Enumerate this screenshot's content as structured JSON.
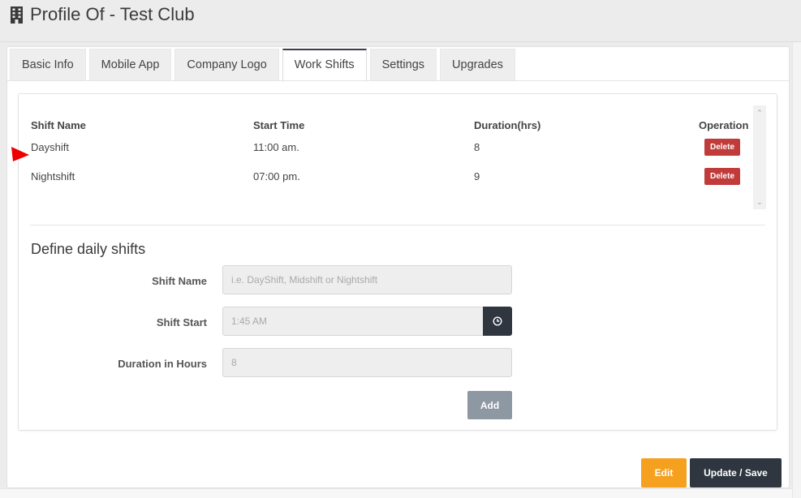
{
  "page": {
    "title": "Profile Of - Test Club",
    "title_icon": "building-icon"
  },
  "tabs": [
    {
      "label": "Basic Info",
      "active": false
    },
    {
      "label": "Mobile App",
      "active": false
    },
    {
      "label": "Company Logo",
      "active": false
    },
    {
      "label": "Work Shifts",
      "active": true
    },
    {
      "label": "Settings",
      "active": false
    },
    {
      "label": "Upgrades",
      "active": false
    }
  ],
  "shifts_table": {
    "columns": [
      "Shift Name",
      "Start Time",
      "Duration(hrs)",
      "Operation"
    ],
    "rows": [
      {
        "name": "Dayshift",
        "start": "11:00 am.",
        "duration": "8",
        "action": "Delete"
      },
      {
        "name": "Nightshift",
        "start": "07:00 pm.",
        "duration": "9",
        "action": "Delete"
      }
    ]
  },
  "form": {
    "title": "Define daily shifts",
    "shift_name_label": "Shift Name",
    "shift_name_placeholder": "i.e. DayShift, Midshift or Nightshift",
    "shift_start_label": "Shift Start",
    "shift_start_placeholder": "1:45 AM",
    "duration_label": "Duration in Hours",
    "duration_placeholder": "8",
    "add_label": "Add",
    "clock_icon": "clock-icon"
  },
  "footer": {
    "edit_label": "Edit",
    "save_label": "Update / Save"
  },
  "colors": {
    "delete": "#c13b3b",
    "edit": "#f6a020",
    "dark": "#2f3640",
    "add": "#8e98a3",
    "annotation_arrow": "#ee0000"
  }
}
